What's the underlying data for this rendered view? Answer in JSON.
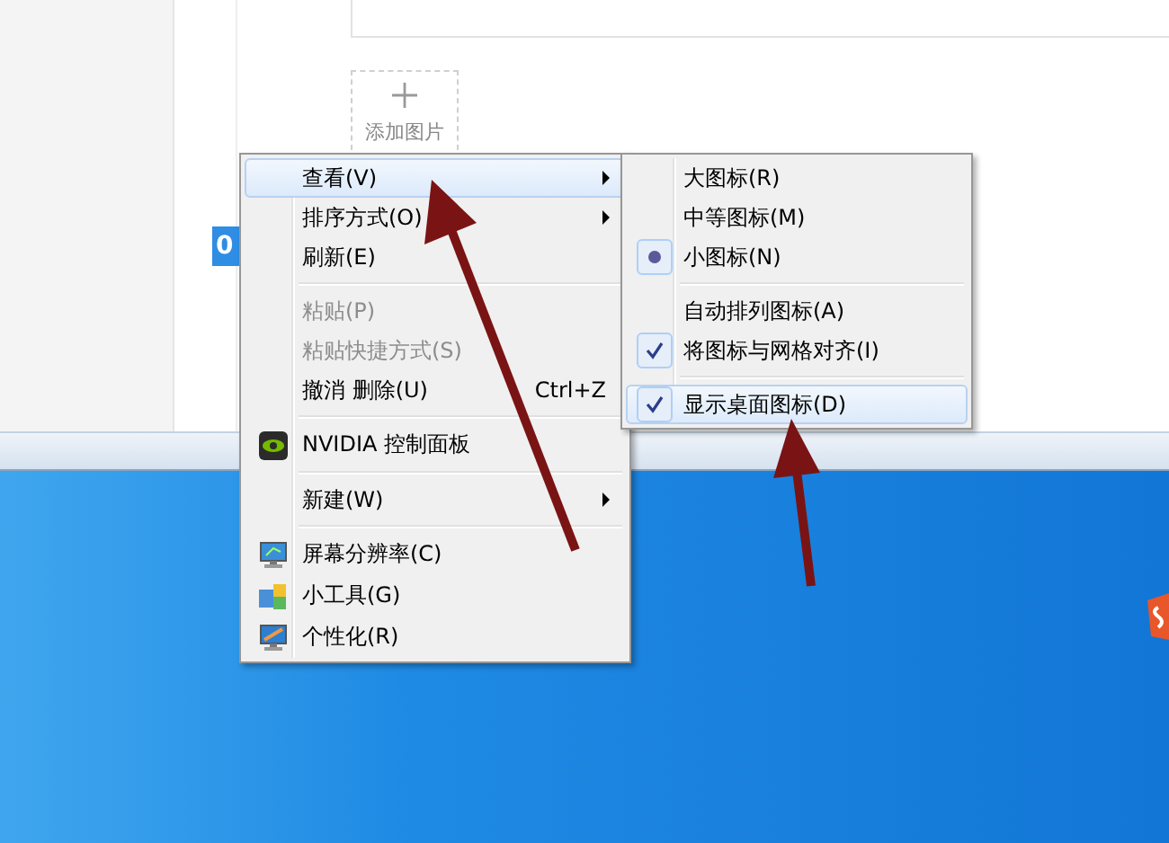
{
  "page": {
    "add_image_label": "添加图片",
    "badge": "0"
  },
  "context_menu": {
    "items": [
      {
        "kind": "item",
        "label": "查看(V)",
        "selected": true,
        "disabled": false,
        "submenu": true,
        "has_icon": false
      },
      {
        "kind": "item",
        "label": "排序方式(O)",
        "selected": false,
        "disabled": false,
        "submenu": true,
        "has_icon": false
      },
      {
        "kind": "item",
        "label": "刷新(E)",
        "selected": false,
        "disabled": false,
        "submenu": false,
        "has_icon": false
      },
      {
        "kind": "separator"
      },
      {
        "kind": "item",
        "label": "粘贴(P)",
        "selected": false,
        "disabled": true,
        "submenu": false,
        "has_icon": false
      },
      {
        "kind": "item",
        "label": "粘贴快捷方式(S)",
        "selected": false,
        "disabled": true,
        "submenu": false,
        "has_icon": false
      },
      {
        "kind": "item",
        "label": "撤消 删除(U)",
        "shortcut": "Ctrl+Z",
        "selected": false,
        "disabled": false,
        "submenu": false,
        "has_icon": false
      },
      {
        "kind": "separator"
      },
      {
        "kind": "item",
        "label": "NVIDIA 控制面板",
        "selected": false,
        "disabled": false,
        "submenu": false,
        "has_icon": true
      },
      {
        "kind": "separator"
      },
      {
        "kind": "item",
        "label": "新建(W)",
        "selected": false,
        "disabled": false,
        "submenu": true,
        "has_icon": false
      },
      {
        "kind": "separator"
      },
      {
        "kind": "item",
        "label": "屏幕分辨率(C)",
        "selected": false,
        "disabled": false,
        "submenu": false,
        "has_icon": true
      },
      {
        "kind": "item",
        "label": "小工具(G)",
        "selected": false,
        "disabled": false,
        "submenu": false,
        "has_icon": true
      },
      {
        "kind": "item",
        "label": "个性化(R)",
        "selected": false,
        "disabled": false,
        "submenu": false,
        "has_icon": true
      }
    ]
  },
  "view_submenu": {
    "items": [
      {
        "kind": "radio",
        "label": "大图标(R)",
        "checked": false,
        "selected": false
      },
      {
        "kind": "radio",
        "label": "中等图标(M)",
        "checked": false,
        "selected": false
      },
      {
        "kind": "radio",
        "label": "小图标(N)",
        "checked": true,
        "selected": false
      },
      {
        "kind": "separator"
      },
      {
        "kind": "check",
        "label": "自动排列图标(A)",
        "checked": false,
        "selected": false
      },
      {
        "kind": "check",
        "label": "将图标与网格对齐(I)",
        "checked": true,
        "selected": false
      },
      {
        "kind": "separator"
      },
      {
        "kind": "check",
        "label": "显示桌面图标(D)",
        "checked": true,
        "selected": true
      }
    ]
  }
}
